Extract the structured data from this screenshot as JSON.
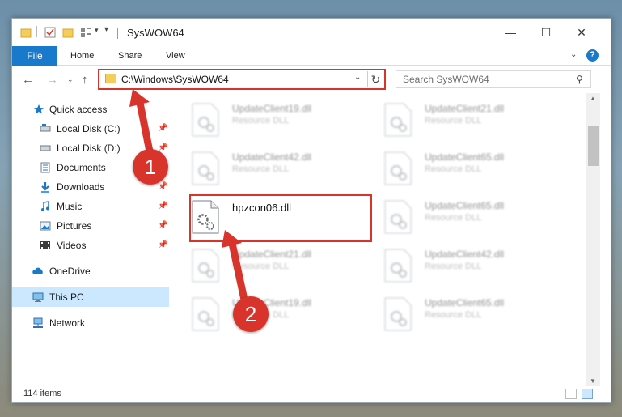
{
  "window": {
    "title": "SysWOW64"
  },
  "ribbon": {
    "file": "File",
    "home": "Home",
    "share": "Share",
    "view": "View"
  },
  "navbar": {
    "address": "C:\\Windows\\SysWOW64",
    "search_placeholder": "Search SysWOW64"
  },
  "sidebar": {
    "items": [
      {
        "label": "Quick access",
        "icon": "star-icon"
      },
      {
        "label": "Local Disk (C:)",
        "icon": "drive-icon",
        "pinned": true
      },
      {
        "label": "Local Disk (D:)",
        "icon": "drive-icon",
        "pinned": true
      },
      {
        "label": "Documents",
        "icon": "documents-icon",
        "pinned": true
      },
      {
        "label": "Downloads",
        "icon": "download-icon",
        "pinned": true
      },
      {
        "label": "Music",
        "icon": "music-icon",
        "pinned": true
      },
      {
        "label": "Pictures",
        "icon": "pictures-icon",
        "pinned": true
      },
      {
        "label": "Videos",
        "icon": "video-icon",
        "pinned": true
      },
      {
        "label": "OneDrive",
        "icon": "cloud-icon"
      },
      {
        "label": "This PC",
        "icon": "computer-icon",
        "selected": true
      },
      {
        "label": "Network",
        "icon": "network-icon"
      }
    ]
  },
  "files": [
    {
      "name": "UpdateClient19.dll",
      "type": "Resource DLL"
    },
    {
      "name": "UpdateClient21.dll",
      "type": "Resource DLL"
    },
    {
      "name": "UpdateClient42.dll",
      "type": "Resource DLL"
    },
    {
      "name": "UpdateClient65.dll",
      "type": "Resource DLL"
    },
    {
      "name": "hpzcon06.dll",
      "type": ""
    },
    {
      "name": "UpdateClient65.dll",
      "type": "Resource DLL"
    },
    {
      "name": "UpdateClient21.dll",
      "type": "Resource DLL"
    },
    {
      "name": "UpdateClient42.dll",
      "type": "Resource DLL"
    },
    {
      "name": "UpdateClient19.dll",
      "type": "Resource DLL"
    },
    {
      "name": "UpdateClient65.dll",
      "type": "Resource DLL"
    }
  ],
  "status": {
    "count": "114 items"
  },
  "annotations": {
    "step1": "1",
    "step2": "2"
  },
  "colors": {
    "accent": "#1979ca",
    "highlight": "#d9342c",
    "selected": "#cce8ff"
  }
}
